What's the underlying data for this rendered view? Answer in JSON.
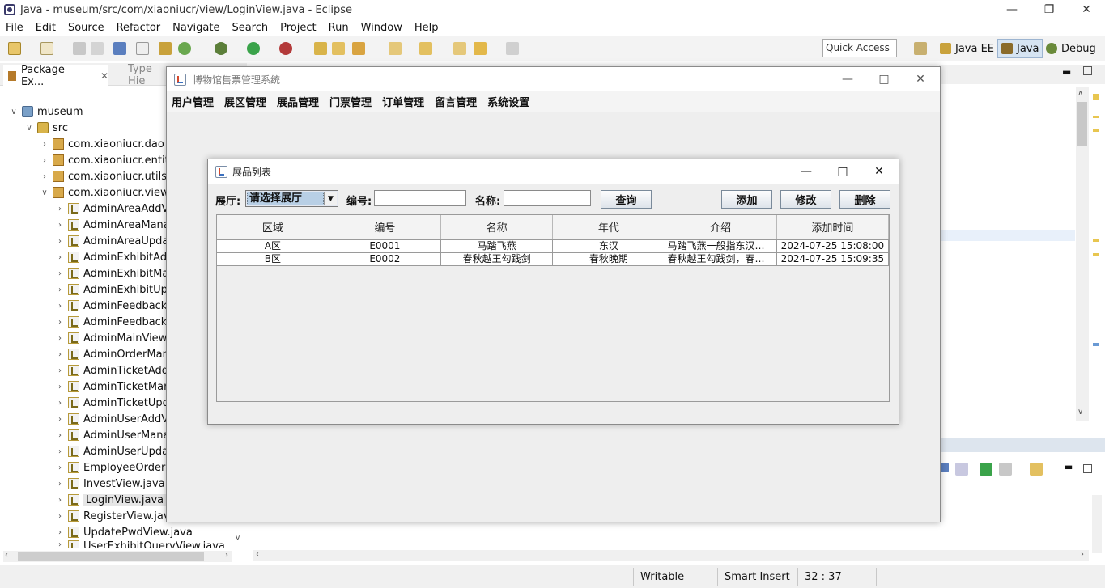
{
  "window": {
    "title": "Java - museum/src/com/xiaoniucr/view/LoginView.java - Eclipse"
  },
  "menubar": [
    "File",
    "Edit",
    "Source",
    "Refactor",
    "Navigate",
    "Search",
    "Project",
    "Run",
    "Window",
    "Help"
  ],
  "toolbar": {
    "quick_access": "Quick Access"
  },
  "perspectives": [
    "Java EE",
    "Java",
    "Debug"
  ],
  "left_panel": {
    "tabs": [
      "Package Ex...",
      "Type Hie"
    ],
    "tree": {
      "project": "museum",
      "src": "src",
      "packages": [
        "com.xiaoniucr.dao",
        "com.xiaoniucr.entity",
        "com.xiaoniucr.utils",
        "com.xiaoniucr.view"
      ],
      "files": [
        "AdminAreaAddVi",
        "AdminAreaManag",
        "AdminAreaUpdat",
        "AdminExhibitAdd",
        "AdminExhibitMan",
        "AdminExhibitUpd",
        "AdminFeedbackM",
        "AdminFeedbackR",
        "AdminMainView.j",
        "AdminOrderMana",
        "AdminTicketAddV",
        "AdminTicketMana",
        "AdminTicketUpda",
        "AdminUserAddVi",
        "AdminUserManag",
        "AdminUserUpdat",
        "EmployeeOrderM",
        "InvestView.java",
        "LoginView.java",
        "RegisterView.java",
        "UpdatePwdView.java",
        "UserExhibitQueryView.java"
      ],
      "selected_file": "LoginView.java"
    }
  },
  "statusbar": {
    "writable": "Writable",
    "insert_mode": "Smart Insert",
    "position": "32 : 37"
  },
  "main_frame": {
    "title": "博物馆售票管理系统",
    "menu": [
      "用户管理",
      "展区管理",
      "展品管理",
      "门票管理",
      "订单管理",
      "留言管理",
      "系统设置"
    ]
  },
  "dialog": {
    "title": "展品列表",
    "hall_label": "展厅:",
    "hall_selected": "请选择展厅",
    "code_label": "编号:",
    "name_label": "名称:",
    "code_value": "",
    "name_value": "",
    "buttons": {
      "query": "查询",
      "add": "添加",
      "edit": "修改",
      "delete": "删除"
    },
    "table": {
      "columns": [
        "区域",
        "编号",
        "名称",
        "年代",
        "介绍",
        "添加时间"
      ],
      "rows": [
        [
          "A区",
          "E0001",
          "马踏飞燕",
          "东汉",
          "马踏飞燕一般指东汉铜奔马",
          "2024-07-25 15:08:00"
        ],
        [
          "B区",
          "E0002",
          "春秋越王勾践剑",
          "春秋晚期",
          "春秋越王勾践剑，春秋晚期越国",
          "2024-07-25 15:09:35"
        ]
      ]
    }
  }
}
